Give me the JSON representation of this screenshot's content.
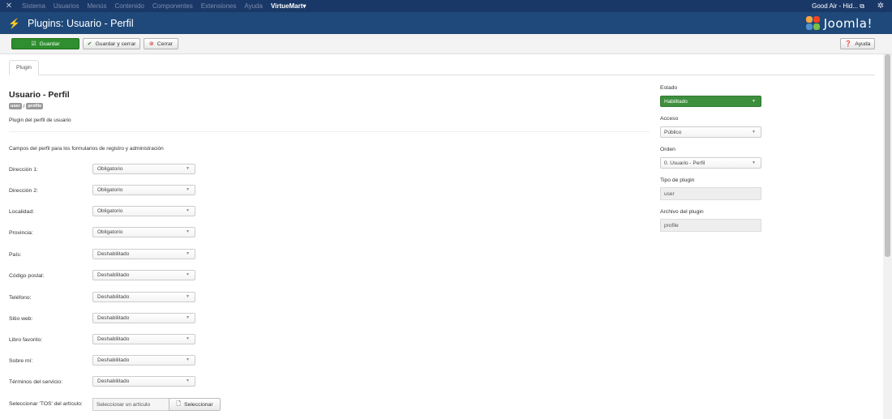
{
  "nav": {
    "items": [
      "Sistema",
      "Usuarios",
      "Menús",
      "Contenido",
      "Componentes",
      "Extensiones",
      "Ayuda"
    ],
    "virtuemart": "VirtueMart",
    "user": "Good Air - Hid..."
  },
  "header": {
    "title": "Plugins: Usuario - Perfil",
    "logo_text": "Joomla!"
  },
  "toolbar": {
    "save_label": "Guardar",
    "save_close_label": "Guardar y cerrar",
    "close_label": "Cerrar",
    "help_label": "Ayuda"
  },
  "tabs": {
    "plugin": "Plugin"
  },
  "main": {
    "title": "Usuario - Perfil",
    "badge_user": "user",
    "badge_separator": "/",
    "badge_profile": "profile",
    "description": "Plugin del perfil de usuario",
    "subtitle": "Campos del perfil para los formularios de registro y administración",
    "fields": [
      {
        "label": "Dirección 1:",
        "value": "Obligatorio"
      },
      {
        "label": "Dirección 2:",
        "value": "Obligatorio"
      },
      {
        "label": "Localidad:",
        "value": "Obligatorio"
      },
      {
        "label": "Provincia:",
        "value": "Obligatorio"
      },
      {
        "label": "País:",
        "value": "Deshabilitado"
      },
      {
        "label": "Código postal:",
        "value": "Deshabilitado"
      },
      {
        "label": "Teléfono:",
        "value": "Deshabilitado"
      },
      {
        "label": "Sitio web:",
        "value": "Deshabilitado"
      },
      {
        "label": "Libro favorito:",
        "value": "Deshabilitado"
      },
      {
        "label": "Sobre mí:",
        "value": "Deshabilitado"
      },
      {
        "label": "Términos del servicio:",
        "value": "Deshabilitado"
      }
    ],
    "tos": {
      "label": "Seleccionar 'TOS' del artículo:",
      "placeholder": "Seleccionar un artículo",
      "button": "Seleccionar"
    }
  },
  "side": {
    "estado_label": "Estado",
    "estado_value": "Habilitado",
    "acceso_label": "Acceso",
    "acceso_value": "Público",
    "orden_label": "Orden",
    "orden_value": "0. Usuario - Perfil",
    "tipo_label": "Tipo de plugin",
    "tipo_value": "user",
    "archivo_label": "Archivo del plugin",
    "archivo_value": "profile"
  },
  "colors": {
    "navbar": "#1a3867",
    "header": "#1f497a",
    "save": "#2f8e2f",
    "enabled": "#3d8f3d"
  }
}
